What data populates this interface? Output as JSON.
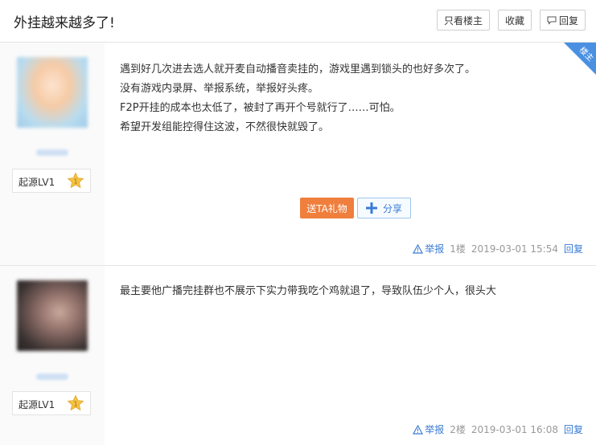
{
  "header": {
    "title": "外挂越来越多了!",
    "only_op_label": "只看楼主",
    "favorite_label": "收藏",
    "reply_label": "回复"
  },
  "posts": [
    {
      "badge": "楼主",
      "level": "起源LV1",
      "lines": [
        "遇到好几次进去选人就开麦自动播音卖挂的，游戏里遇到锁头的也好多次了。",
        "没有游戏内录屏、举报系统，举报好头疼。",
        "F2P开挂的成本也太低了，被封了再开个号就行了……可怕。",
        "希望开发组能控得住这波，不然很快就毁了。"
      ],
      "gift_label": "送TA礼物",
      "share_label": "分享",
      "report_label": "举报",
      "floor": "1楼",
      "time": "2019-03-01 15:54",
      "reply_label": "回复"
    },
    {
      "level": "起源LV1",
      "lines": [
        "最主要他广播完挂群也不展示下实力带我吃个鸡就退了，导致队伍少个人，很头大"
      ],
      "report_label": "举报",
      "floor": "2楼",
      "time": "2019-03-01 16:08",
      "reply_label": "回复"
    }
  ],
  "colors": {
    "accent_blue": "#3a7bd5",
    "gift_orange": "#f07e3c",
    "badge_blue": "#4a90e2",
    "star_gold": "#f5c242"
  },
  "icons": {
    "reply": "speech-bubble-icon",
    "level": "star-icon",
    "share": "plus-icon",
    "report": "warning-triangle-icon"
  }
}
